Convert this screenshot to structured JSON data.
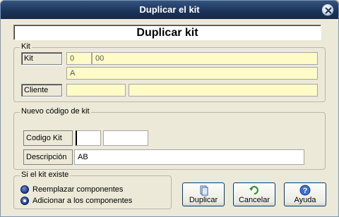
{
  "window": {
    "title": "Duplicar el kit"
  },
  "header": {
    "title": "Duplicar kit"
  },
  "kit_group": {
    "legend": "Kit",
    "kit_label": "Kit",
    "kit_code_1": "0",
    "kit_code_2": "00",
    "kit_desc": "A",
    "cliente_label": "Cliente",
    "cliente_code": "",
    "cliente_name": ""
  },
  "new_group": {
    "legend": "Nuevo código de kit",
    "codigo_label": "Codigo Kit",
    "codigo_value_1": "",
    "codigo_value_2": "",
    "descripcion_label": "Descripción",
    "descripcion_value": "AB"
  },
  "exists_group": {
    "legend": "Si el kit existe",
    "option_replace": "Reemplazar componentes",
    "option_add": "Adicionar a los componentes",
    "selected": "option_add"
  },
  "buttons": {
    "duplicar": "Duplicar",
    "cancelar": "Cancelar",
    "ayuda": "Ayuda"
  },
  "colors": {
    "titlebar": "#1b3258",
    "field_yellow": "#fffbc6",
    "dialog_bg": "#ece9d8"
  }
}
